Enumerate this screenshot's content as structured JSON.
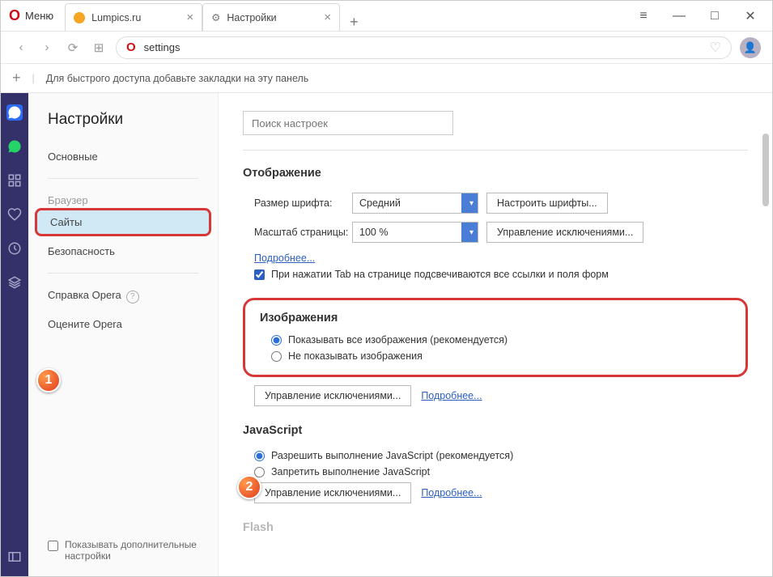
{
  "menu_label": "Меню",
  "tabs": [
    {
      "title": "Lumpics.ru",
      "favicon_color": "#f5a623"
    },
    {
      "title": "Настройки",
      "is_settings": true
    }
  ],
  "address_bar": {
    "text": "settings"
  },
  "bookmark_bar": {
    "hint": "Для быстрого доступа добавьте закладки на эту панель"
  },
  "sidebar": {
    "title": "Настройки",
    "items": [
      {
        "label": "Основные"
      },
      {
        "label": "Браузер"
      },
      {
        "label": "Сайты",
        "active": true
      },
      {
        "label": "Безопасность"
      }
    ],
    "help_label": "Справка Opera",
    "rate_label": "Оцените Opera",
    "advanced_label": "Показывать дополнительные настройки"
  },
  "content": {
    "search_placeholder": "Поиск настроек",
    "display": {
      "title": "Отображение",
      "font_size_label": "Размер шрифта:",
      "font_size_value": "Средний",
      "font_button": "Настроить шрифты...",
      "zoom_label": "Масштаб страницы:",
      "zoom_value": "100 %",
      "zoom_button": "Управление исключениями...",
      "more_link": "Подробнее...",
      "tab_checkbox": "При нажатии Tab на странице подсвечиваются все ссылки и поля форм"
    },
    "images": {
      "title": "Изображения",
      "option_show": "Показывать все изображения (рекомендуется)",
      "option_hide": "Не показывать изображения",
      "exceptions_btn": "Управление исключениями...",
      "more_link": "Подробнее..."
    },
    "javascript": {
      "title": "JavaScript",
      "option_allow": "Разрешить выполнение JavaScript (рекомендуется)",
      "option_block": "Запретить выполнение JavaScript",
      "exceptions_btn": "Управление исключениями...",
      "more_link": "Подробнее..."
    },
    "flash_title": "Flash"
  },
  "badges": {
    "one": "1",
    "two": "2"
  }
}
